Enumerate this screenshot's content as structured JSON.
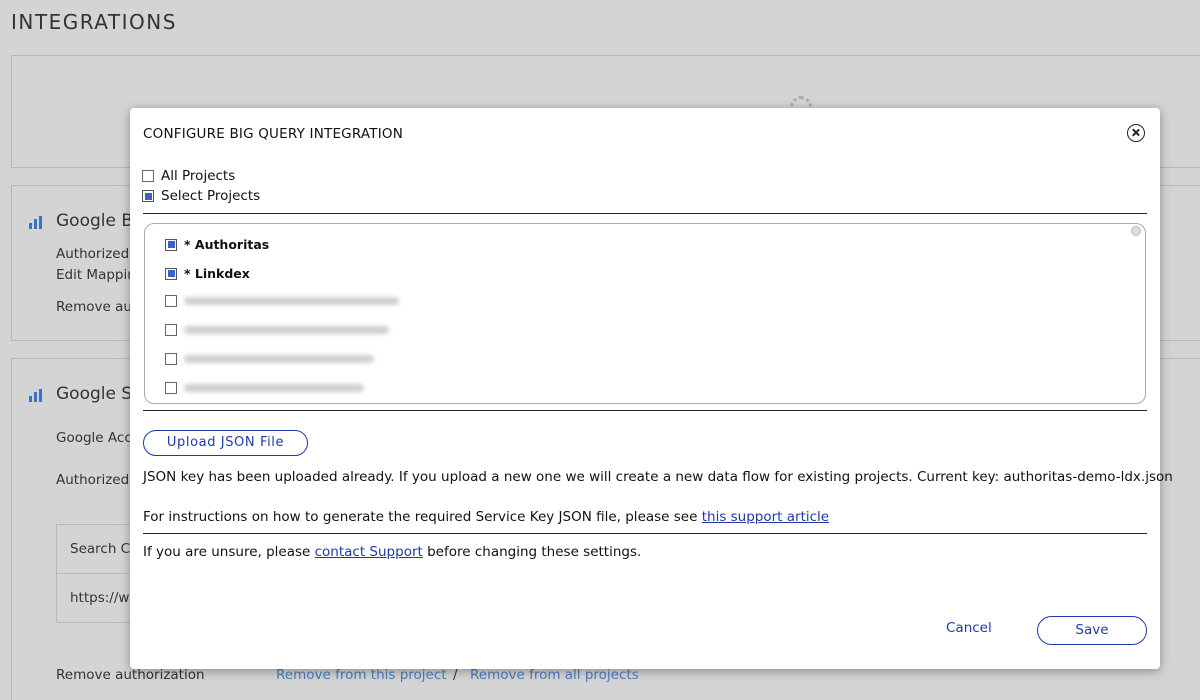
{
  "background": {
    "page_title": "INTEGRATIONS",
    "bq_panel": {
      "heading": "Google B",
      "line1": "Authorized",
      "line2": "Edit Mappin",
      "line3": "Remove au"
    },
    "gsc_panel": {
      "heading": "Google S",
      "line1": "Google Acc",
      "line2": "Authorized",
      "search_label": "Search C",
      "url_text": "https://w",
      "remove_label": "Remove authorization",
      "remove_this": "Remove from this project",
      "separator": "/",
      "remove_all": "Remove from all projects"
    }
  },
  "modal": {
    "title": "CONFIGURE BIG QUERY INTEGRATION",
    "options": {
      "all_projects": {
        "label": "All Projects",
        "checked": false
      },
      "select_projects": {
        "label": "Select Projects",
        "checked": true
      }
    },
    "projects": [
      {
        "label": "* Authoritas",
        "checked": true
      },
      {
        "label": "* Linkdex",
        "checked": true
      },
      {
        "label": "",
        "checked": false
      },
      {
        "label": "",
        "checked": false
      },
      {
        "label": "",
        "checked": false
      },
      {
        "label": "",
        "checked": false
      }
    ],
    "upload_label": "Upload JSON File",
    "key_message": "JSON key has been uploaded already. If you upload a new one we will create a new data flow for existing projects. Current key: authoritas-demo-ldx.json",
    "instructions_prefix": "For instructions on how to generate the required Service Key JSON file, please see ",
    "instructions_link": "this support article",
    "unsure_prefix": "If you are unsure, please ",
    "unsure_link": "contact Support",
    "unsure_suffix": " before changing these settings.",
    "cancel_label": "Cancel",
    "save_label": "Save"
  },
  "colors": {
    "accent": "#1f3aa8",
    "checkbox_fill": "#3a5fd0",
    "background_dim": "#d4d4d4"
  }
}
